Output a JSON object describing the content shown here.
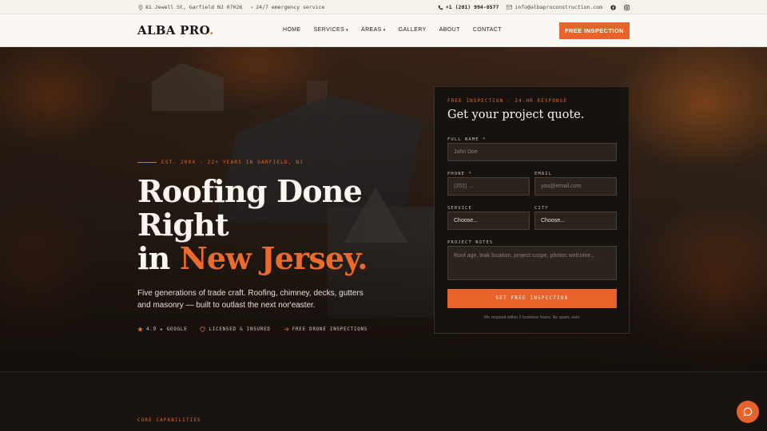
{
  "topbar": {
    "address": "81 Jewell St, Garfield NJ 07026",
    "emergency": "24/7 emergency service",
    "phone": "+1 (201) 994-8577",
    "email": "info@albaproconstruction.com",
    "social": [
      "facebook-icon",
      "instagram-icon"
    ]
  },
  "nav": {
    "logo_text": "ALBA PRO",
    "logo_dot": ".",
    "items": [
      {
        "label": "HOME",
        "dropdown": false
      },
      {
        "label": "SERVICES",
        "dropdown": true
      },
      {
        "label": "AREAS",
        "dropdown": true
      },
      {
        "label": "GALLERY",
        "dropdown": false
      },
      {
        "label": "ABOUT",
        "dropdown": false
      },
      {
        "label": "CONTACT",
        "dropdown": false
      }
    ],
    "cta": "FREE INSPECTION"
  },
  "hero": {
    "eyebrow": "EST. 2004 · 22+ YEARS IN GARFIELD, NJ",
    "headline_line1": "Roofing Done",
    "headline_line2": "Right",
    "headline_line3_prefix": "in ",
    "headline_accent": "New Jersey.",
    "lead": "Five generations of trade craft. Roofing, chimney, decks, gutters and masonry — built to outlast the next nor'easter.",
    "badges": [
      "4.9 ★ GOOGLE",
      "LICENSED & INSURED",
      "FREE DRONE INSPECTIONS"
    ]
  },
  "form": {
    "tag": "FREE INSPECTION · 24-HR RESPONSE",
    "title": "Get your project quote.",
    "full_name_label": "FULL NAME *",
    "full_name_placeholder": "John Doe",
    "phone_label": "PHONE *",
    "phone_placeholder": "(201) ...",
    "email_label": "EMAIL",
    "email_placeholder": "you@email.com",
    "service_label": "SERVICE",
    "service_value": "Choose...",
    "city_label": "CITY",
    "city_value": "Choose...",
    "notes_label": "PROJECT NOTES",
    "notes_placeholder": "Roof age, leak location, project scope, photos welcome...",
    "submit": "GET FREE INSPECTION",
    "fine_print": "We respond within 2 business hours. No spam, ever."
  },
  "lower": {
    "section_label": "CORE CAPABILITIES"
  },
  "colors": {
    "accent": "#e8632a",
    "dark": "#1a1410",
    "cream": "#fbf8f3"
  }
}
